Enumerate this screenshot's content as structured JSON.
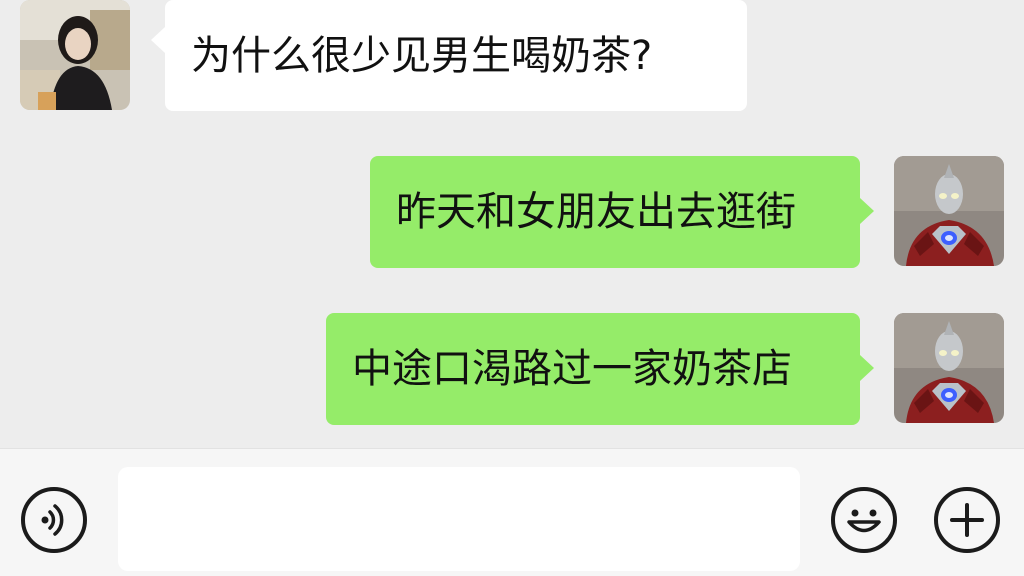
{
  "messages": [
    {
      "side": "left",
      "text": "为什么很少见男生喝奶茶?"
    },
    {
      "side": "right",
      "text": "昨天和女朋友出去逛街"
    },
    {
      "side": "right",
      "text": "中途口渴路过一家奶茶店"
    }
  ],
  "input": {
    "value": ""
  },
  "icons": {
    "voice": "voice-icon",
    "emoji": "emoji-icon",
    "plus": "plus-icon"
  },
  "colors": {
    "background": "#ededed",
    "incoming_bubble": "#ffffff",
    "outgoing_bubble": "#95ec69"
  }
}
